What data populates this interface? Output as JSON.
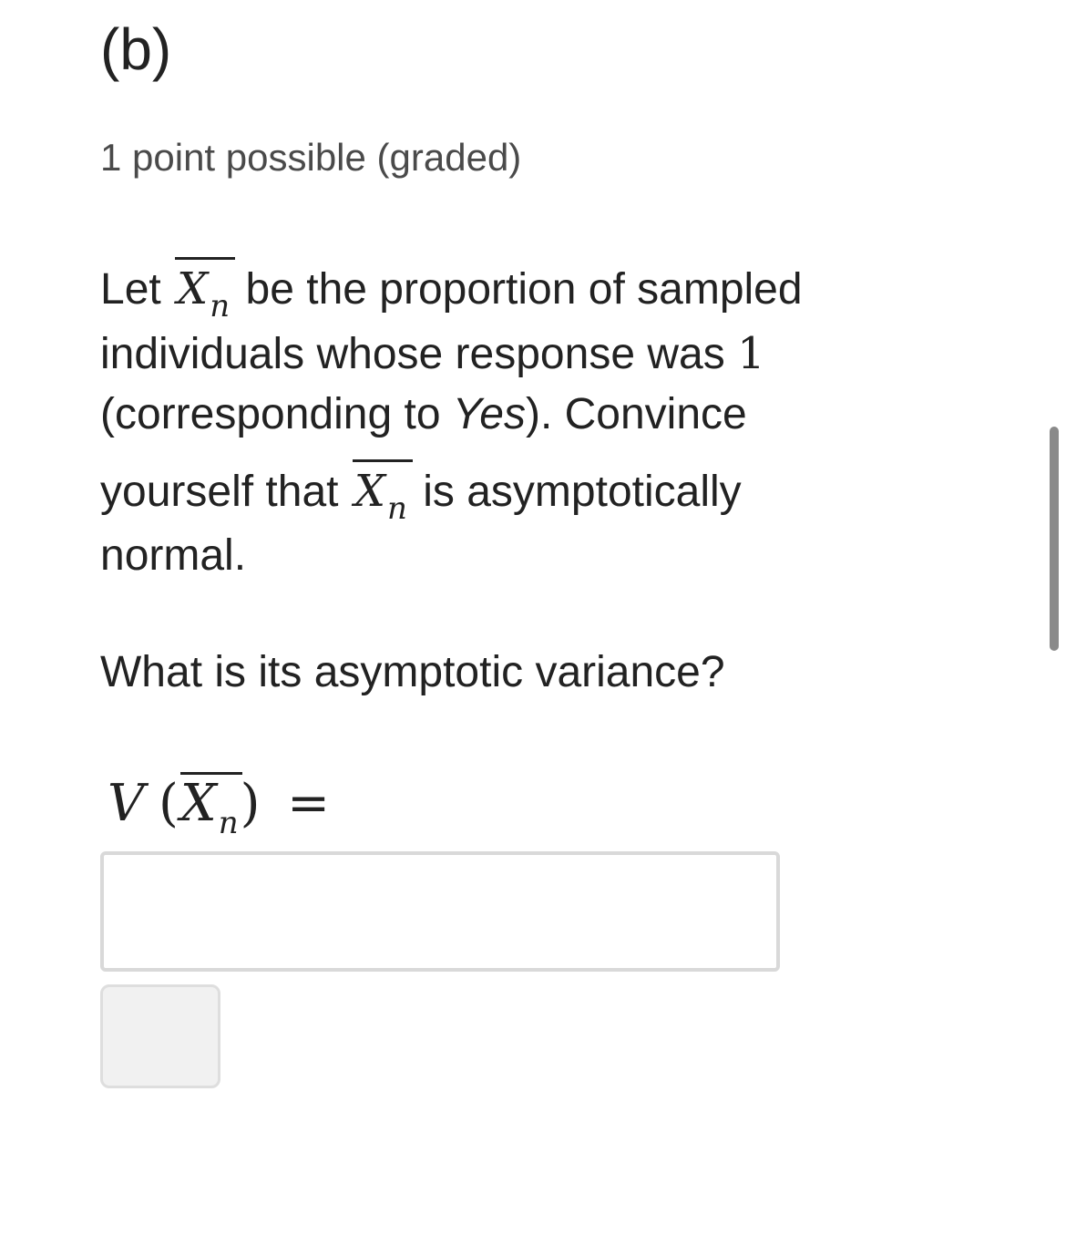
{
  "problem": {
    "title": "(b)",
    "points": "1 point possible (graded)"
  },
  "prompt": {
    "line1_pre": "Let",
    "xbar_symbol": "X",
    "xbar_sub": "n",
    "line1_post": "be the proportion of sampled",
    "line2_pre": "individuals whose response was",
    "line2_value": "1",
    "line3_pre": "(corresponding to",
    "line3_italic": "Yes",
    "line3_post": "). Convince",
    "line4_pre": "yourself that",
    "line4_post": "is asymptotically",
    "line5": "normal."
  },
  "question": "What is its asymptotic variance?",
  "formula": {
    "func": "V",
    "open": "(",
    "symbol": "X",
    "sub": "n",
    "close": ")",
    "equals": "="
  },
  "answer": {
    "value": ""
  }
}
